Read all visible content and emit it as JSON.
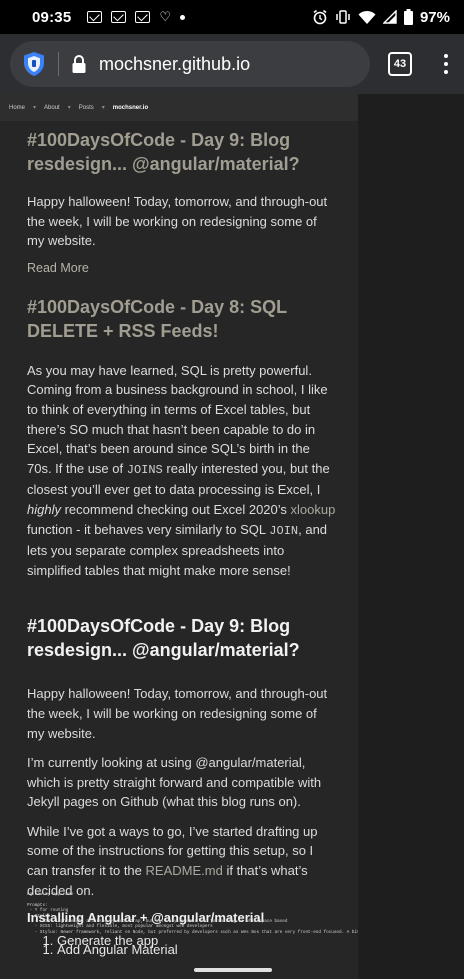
{
  "status": {
    "time": "09:35",
    "battery": "97%"
  },
  "browser": {
    "url": "mochsner.github.io",
    "tab_count": "43"
  },
  "nav": {
    "items": [
      "Home",
      "About",
      "Posts"
    ],
    "brand": "mochsner.io"
  },
  "posts": [
    {
      "title": "#100DaysOfCode - Day 9: Blog resdesign... @angular/material?",
      "excerpt": "Happy halloween! Today, tomorrow, and through-out the week, I will be working on redesigning some of my website.",
      "read_more": "Read More"
    },
    {
      "title": "#100DaysOfCode - Day 8: SQL DELETE + RSS Feeds!",
      "body_1": "As you may have learned, SQL is pretty powerful. Coming from a business background in school, I like to think of everything in terms of Excel tables, but there’s SO much that hasn’t been capable to do in Excel, that’s been around since SQL’s birth in the 70s. If the use of",
      "code_joins": "JOINS",
      "body_2": "really interested you, but the closest you’ll ever get to data processing is Excel, I",
      "highly": "highly",
      "body_3": "recommend checking out Excel 2020’s",
      "xlookup": "xlookup",
      "body_4": "function - it behaves very similarly to SQL",
      "code_join": "JOIN",
      "body_5": ", and lets you separate complex spreadsheets into simplified tables that might make more sense!"
    }
  ],
  "article": {
    "title": "#100DaysOfCode - Day 9: Blog resdesign... @angular/material?",
    "p1": "Happy halloween! Today, tomorrow, and through-out the week, I will be working on redesigning some of my website.",
    "p2": "I’m currently looking at using @angular/material, which is pretty straight forward and compatible with Jekyll pages on Github (what this blog runs on).",
    "p3_a": "While I’ve got a ways to go, I’ve started drafting up some of the instructions for getting this setup, so I can transfer it to the",
    "p3_link": "README.md",
    "p3_b": "if that’s what’s decided on.",
    "heading": "Installing Angular + @angular/material",
    "step1": "Generate the app",
    "code_block": "ng new my-app-name\n\nPrompts:\n - Y for routing\n - Styles:\n   - LESS: lightweight and used by bootstrap, but not very dynamic and formatting is whitespace based\n   - SCSS: lightweight and flexible, most popular amongst web developers\n   - Stylus: Newer framework, reliant on Node, but preferred by developers such as Wes Bos that are very front-end focused. A bit more features with skipping variables",
    "step2": "Add Angular Material"
  }
}
